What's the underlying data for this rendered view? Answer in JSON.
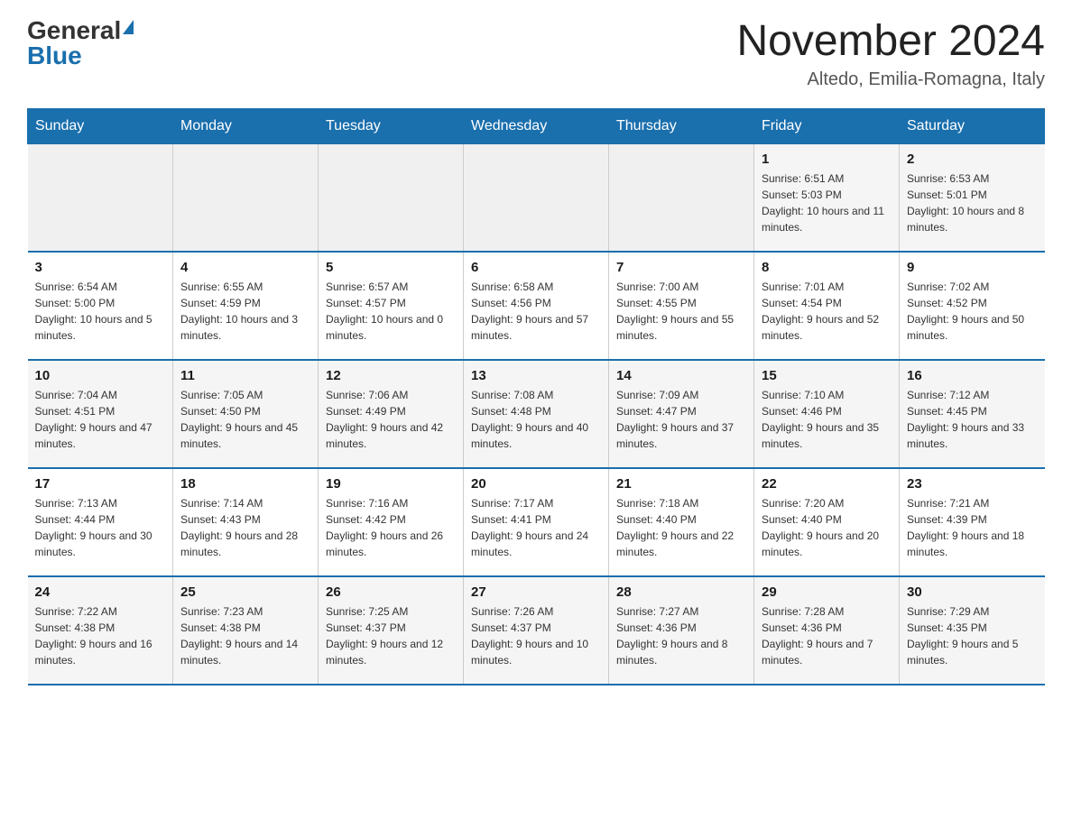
{
  "header": {
    "logo_general": "General",
    "logo_blue": "Blue",
    "month_title": "November 2024",
    "location": "Altedo, Emilia-Romagna, Italy"
  },
  "weekdays": [
    "Sunday",
    "Monday",
    "Tuesday",
    "Wednesday",
    "Thursday",
    "Friday",
    "Saturday"
  ],
  "weeks": [
    [
      {
        "day": "",
        "info": ""
      },
      {
        "day": "",
        "info": ""
      },
      {
        "day": "",
        "info": ""
      },
      {
        "day": "",
        "info": ""
      },
      {
        "day": "",
        "info": ""
      },
      {
        "day": "1",
        "info": "Sunrise: 6:51 AM\nSunset: 5:03 PM\nDaylight: 10 hours and 11 minutes."
      },
      {
        "day": "2",
        "info": "Sunrise: 6:53 AM\nSunset: 5:01 PM\nDaylight: 10 hours and 8 minutes."
      }
    ],
    [
      {
        "day": "3",
        "info": "Sunrise: 6:54 AM\nSunset: 5:00 PM\nDaylight: 10 hours and 5 minutes."
      },
      {
        "day": "4",
        "info": "Sunrise: 6:55 AM\nSunset: 4:59 PM\nDaylight: 10 hours and 3 minutes."
      },
      {
        "day": "5",
        "info": "Sunrise: 6:57 AM\nSunset: 4:57 PM\nDaylight: 10 hours and 0 minutes."
      },
      {
        "day": "6",
        "info": "Sunrise: 6:58 AM\nSunset: 4:56 PM\nDaylight: 9 hours and 57 minutes."
      },
      {
        "day": "7",
        "info": "Sunrise: 7:00 AM\nSunset: 4:55 PM\nDaylight: 9 hours and 55 minutes."
      },
      {
        "day": "8",
        "info": "Sunrise: 7:01 AM\nSunset: 4:54 PM\nDaylight: 9 hours and 52 minutes."
      },
      {
        "day": "9",
        "info": "Sunrise: 7:02 AM\nSunset: 4:52 PM\nDaylight: 9 hours and 50 minutes."
      }
    ],
    [
      {
        "day": "10",
        "info": "Sunrise: 7:04 AM\nSunset: 4:51 PM\nDaylight: 9 hours and 47 minutes."
      },
      {
        "day": "11",
        "info": "Sunrise: 7:05 AM\nSunset: 4:50 PM\nDaylight: 9 hours and 45 minutes."
      },
      {
        "day": "12",
        "info": "Sunrise: 7:06 AM\nSunset: 4:49 PM\nDaylight: 9 hours and 42 minutes."
      },
      {
        "day": "13",
        "info": "Sunrise: 7:08 AM\nSunset: 4:48 PM\nDaylight: 9 hours and 40 minutes."
      },
      {
        "day": "14",
        "info": "Sunrise: 7:09 AM\nSunset: 4:47 PM\nDaylight: 9 hours and 37 minutes."
      },
      {
        "day": "15",
        "info": "Sunrise: 7:10 AM\nSunset: 4:46 PM\nDaylight: 9 hours and 35 minutes."
      },
      {
        "day": "16",
        "info": "Sunrise: 7:12 AM\nSunset: 4:45 PM\nDaylight: 9 hours and 33 minutes."
      }
    ],
    [
      {
        "day": "17",
        "info": "Sunrise: 7:13 AM\nSunset: 4:44 PM\nDaylight: 9 hours and 30 minutes."
      },
      {
        "day": "18",
        "info": "Sunrise: 7:14 AM\nSunset: 4:43 PM\nDaylight: 9 hours and 28 minutes."
      },
      {
        "day": "19",
        "info": "Sunrise: 7:16 AM\nSunset: 4:42 PM\nDaylight: 9 hours and 26 minutes."
      },
      {
        "day": "20",
        "info": "Sunrise: 7:17 AM\nSunset: 4:41 PM\nDaylight: 9 hours and 24 minutes."
      },
      {
        "day": "21",
        "info": "Sunrise: 7:18 AM\nSunset: 4:40 PM\nDaylight: 9 hours and 22 minutes."
      },
      {
        "day": "22",
        "info": "Sunrise: 7:20 AM\nSunset: 4:40 PM\nDaylight: 9 hours and 20 minutes."
      },
      {
        "day": "23",
        "info": "Sunrise: 7:21 AM\nSunset: 4:39 PM\nDaylight: 9 hours and 18 minutes."
      }
    ],
    [
      {
        "day": "24",
        "info": "Sunrise: 7:22 AM\nSunset: 4:38 PM\nDaylight: 9 hours and 16 minutes."
      },
      {
        "day": "25",
        "info": "Sunrise: 7:23 AM\nSunset: 4:38 PM\nDaylight: 9 hours and 14 minutes."
      },
      {
        "day": "26",
        "info": "Sunrise: 7:25 AM\nSunset: 4:37 PM\nDaylight: 9 hours and 12 minutes."
      },
      {
        "day": "27",
        "info": "Sunrise: 7:26 AM\nSunset: 4:37 PM\nDaylight: 9 hours and 10 minutes."
      },
      {
        "day": "28",
        "info": "Sunrise: 7:27 AM\nSunset: 4:36 PM\nDaylight: 9 hours and 8 minutes."
      },
      {
        "day": "29",
        "info": "Sunrise: 7:28 AM\nSunset: 4:36 PM\nDaylight: 9 hours and 7 minutes."
      },
      {
        "day": "30",
        "info": "Sunrise: 7:29 AM\nSunset: 4:35 PM\nDaylight: 9 hours and 5 minutes."
      }
    ]
  ]
}
